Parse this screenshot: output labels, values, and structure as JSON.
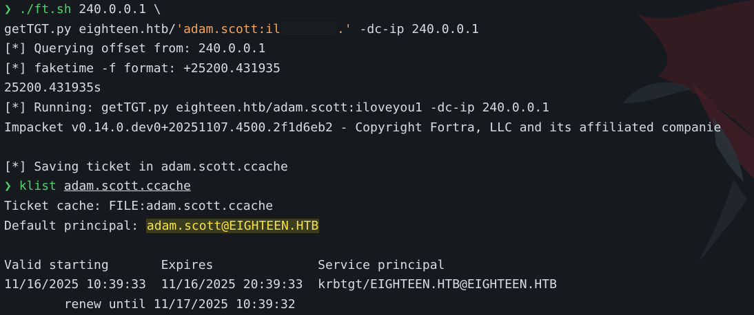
{
  "lines": {
    "l1_prompt": "❯",
    "l1_cmd": "./ft.sh",
    "l1_args": " 240.0.0.1 \\",
    "l2_pre": "getTGT.py eighteen.htb/",
    "l2_str_a": "'adam.scott:il",
    "l2_str_b": ".'",
    "l2_post": " -dc-ip 240.0.0.1",
    "l3": "[*] Querying offset from: 240.0.0.1",
    "l4": "[*] faketime -f format: +25200.431935",
    "l5": "25200.431935s",
    "l6": "[*] Running: getTGT.py eighteen.htb/adam.scott:iloveyou1 -dc-ip 240.0.0.1",
    "l7": "Impacket v0.14.0.dev0+20251107.4500.2f1d6eb2 - Copyright Fortra, LLC and its affiliated companie",
    "l9": "[*] Saving ticket in adam.scott.ccache",
    "l10_prompt": "❯",
    "l10_cmd": "klist",
    "l10_arg": "adam.scott.ccache",
    "l11": "Ticket cache: FILE:adam.scott.ccache",
    "l12_pre": "Default principal: ",
    "l12_principal": "adam.scott@EIGHTEEN.HTB",
    "l14": "Valid starting       Expires              Service principal",
    "l15": "11/16/2025 10:39:33  11/16/2025 20:39:33  krbtgt/EIGHTEEN.HTB@EIGHTEEN.HTB",
    "l16": "        renew until 11/17/2025 10:39:32"
  },
  "colors": {
    "background": "#161a1f",
    "prompt": "#4fd06a",
    "string": "#f2a35a",
    "highlight": "#f2e24a"
  }
}
